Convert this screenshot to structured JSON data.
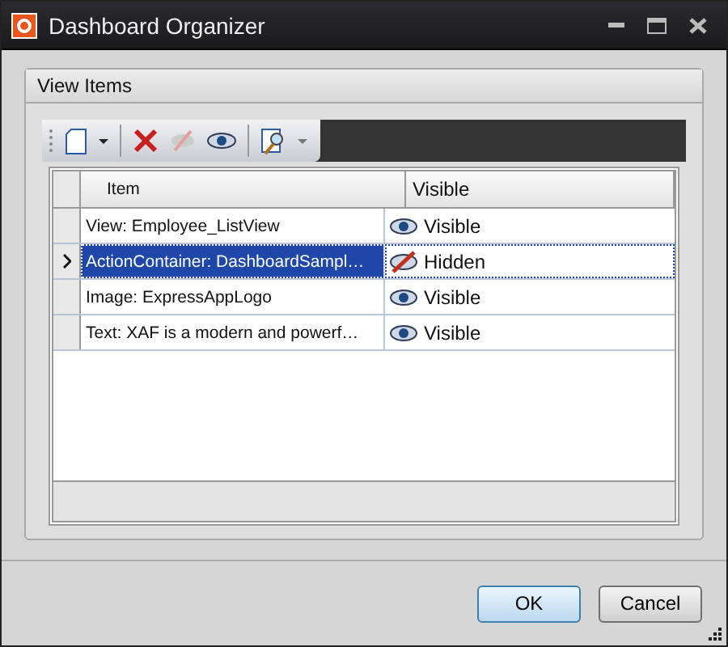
{
  "window": {
    "title": "Dashboard Organizer"
  },
  "group": {
    "title": "View Items"
  },
  "table": {
    "columns": [
      "Item",
      "Visible"
    ],
    "rows": [
      {
        "item": "View: Employee_ListView",
        "visible": true,
        "visibility": "Visible",
        "selected": false
      },
      {
        "item": "ActionContainer: DashboardSampl…",
        "visible": false,
        "visibility": "Hidden",
        "selected": true
      },
      {
        "item": "Image: ExpressAppLogo",
        "visible": true,
        "visibility": "Visible",
        "selected": false
      },
      {
        "item": "Text: XAF is a modern and powerf…",
        "visible": true,
        "visibility": "Visible",
        "selected": false
      }
    ]
  },
  "buttons": [
    {
      "label": "OK",
      "kind": "default"
    },
    {
      "label": "Cancel",
      "kind": "normal"
    }
  ]
}
